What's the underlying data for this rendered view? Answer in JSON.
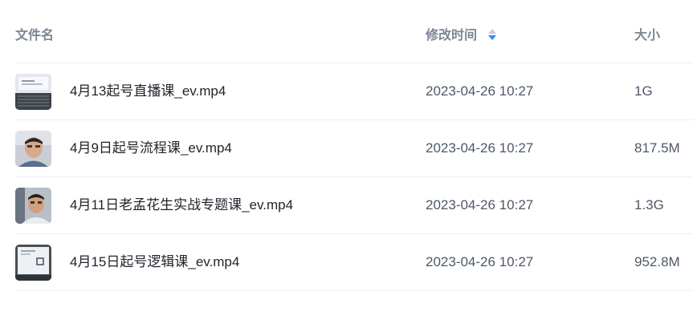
{
  "columns": {
    "name": "文件名",
    "modified": "修改时间",
    "size": "大小"
  },
  "sort": {
    "column": "modified",
    "direction": "desc",
    "active_color": "#2e8ef0"
  },
  "files": [
    {
      "name": "4月13起号直播课_ev.mp4",
      "modified": "2023-04-26 10:27",
      "size": "1G"
    },
    {
      "name": "4月9日起号流程课_ev.mp4",
      "modified": "2023-04-26 10:27",
      "size": "817.5M"
    },
    {
      "name": "4月11日老孟花生实战专题课_ev.mp4",
      "modified": "2023-04-26 10:27",
      "size": "1.3G"
    },
    {
      "name": "4月15日起号逻辑课_ev.mp4",
      "modified": "2023-04-26 10:27",
      "size": "952.8M"
    }
  ]
}
